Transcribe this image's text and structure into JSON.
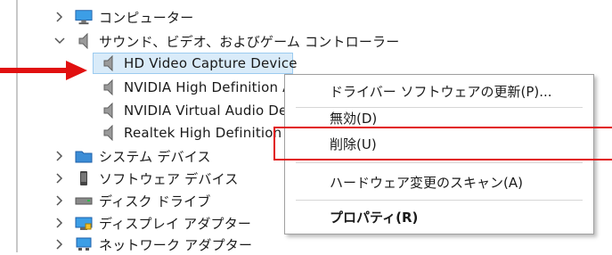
{
  "tree": {
    "computer": {
      "label": "コンピューター",
      "icon": "monitor-icon"
    },
    "sound": {
      "label": "サウンド、ビデオ、およびゲーム コントローラー",
      "icon": "speaker-icon"
    },
    "children": [
      {
        "label": "HD Video Capture Device",
        "icon": "speaker-icon"
      },
      {
        "label": "NVIDIA High Definition Audio",
        "icon": "speaker-icon"
      },
      {
        "label": "NVIDIA Virtual Audio Device",
        "icon": "speaker-icon"
      },
      {
        "label": "Realtek High Definition Audio",
        "icon": "speaker-icon"
      }
    ],
    "after": [
      {
        "label": "システム デバイス",
        "icon": "folder-icon"
      },
      {
        "label": "ソフトウェア デバイス",
        "icon": "phone-icon"
      },
      {
        "label": "ディスク ドライブ",
        "icon": "disk-icon"
      },
      {
        "label": "ディスプレイ アダプター",
        "icon": "display-adapter-icon"
      },
      {
        "label": "ネットワーク アダプター",
        "icon": "network-icon"
      }
    ]
  },
  "context_menu": {
    "items": [
      {
        "label": "ドライバー ソフトウェアの更新(P)..."
      },
      {
        "label": "無効(D)"
      },
      {
        "label": "削除(U)"
      },
      {
        "label": "ハードウェア変更のスキャン(A)"
      },
      {
        "label": "プロパティ(R)"
      }
    ]
  },
  "colors": {
    "highlight": "#d9ebf9",
    "annotation": "#e11010"
  }
}
